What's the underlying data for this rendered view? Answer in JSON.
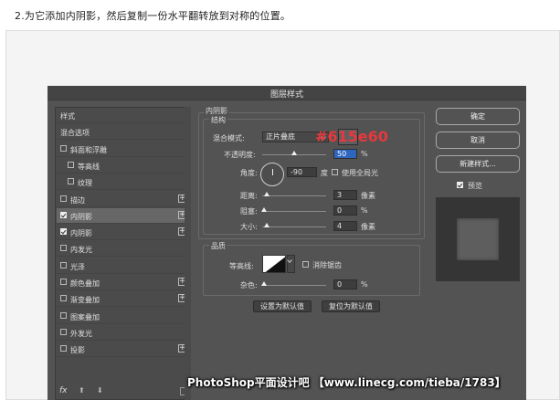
{
  "instruction": "2.为它添加内阴影，然后复制一份水平翻转放到对称的位置。",
  "dialog": {
    "title": "图层样式",
    "sidebar": {
      "items": [
        {
          "label": "样式",
          "checkbox": null,
          "checked": false,
          "plus": false,
          "indent": 0,
          "selected": false
        },
        {
          "label": "混合选项",
          "checkbox": null,
          "checked": false,
          "plus": false,
          "indent": 0,
          "selected": false
        },
        {
          "label": "斜面和浮雕",
          "checkbox": true,
          "checked": false,
          "plus": false,
          "indent": 0,
          "selected": false
        },
        {
          "label": "等高线",
          "checkbox": true,
          "checked": false,
          "plus": false,
          "indent": 1,
          "selected": false
        },
        {
          "label": "纹理",
          "checkbox": true,
          "checked": false,
          "plus": false,
          "indent": 1,
          "selected": false
        },
        {
          "label": "描边",
          "checkbox": true,
          "checked": false,
          "plus": true,
          "indent": 0,
          "selected": false
        },
        {
          "label": "内阴影",
          "checkbox": true,
          "checked": true,
          "plus": true,
          "indent": 0,
          "selected": true
        },
        {
          "label": "内阴影",
          "checkbox": true,
          "checked": true,
          "plus": true,
          "indent": 0,
          "selected": false
        },
        {
          "label": "内发光",
          "checkbox": true,
          "checked": false,
          "plus": false,
          "indent": 0,
          "selected": false
        },
        {
          "label": "光泽",
          "checkbox": true,
          "checked": false,
          "plus": false,
          "indent": 0,
          "selected": false
        },
        {
          "label": "颜色叠加",
          "checkbox": true,
          "checked": false,
          "plus": true,
          "indent": 0,
          "selected": false
        },
        {
          "label": "渐变叠加",
          "checkbox": true,
          "checked": false,
          "plus": true,
          "indent": 0,
          "selected": false
        },
        {
          "label": "图案叠加",
          "checkbox": true,
          "checked": false,
          "plus": false,
          "indent": 0,
          "selected": false
        },
        {
          "label": "外发光",
          "checkbox": true,
          "checked": false,
          "plus": false,
          "indent": 0,
          "selected": false
        },
        {
          "label": "投影",
          "checkbox": true,
          "checked": false,
          "plus": true,
          "indent": 0,
          "selected": false
        }
      ],
      "fx_label": "fx"
    },
    "inner_shadow": {
      "section_title": "内阴影",
      "structure_title": "结构",
      "blend_mode_label": "混合模式:",
      "blend_mode_value": "正片叠底",
      "shadow_color": "#615e60",
      "opacity_label": "不透明度:",
      "opacity_value": "50",
      "opacity_unit": "%",
      "angle_label": "角度:",
      "angle_value": "-90",
      "angle_unit": "度",
      "global_light_label": "使用全局光",
      "global_light_checked": false,
      "distance_label": "距离:",
      "distance_value": "3",
      "distance_unit": "像素",
      "choke_label": "阻塞:",
      "choke_value": "0",
      "choke_unit": "%",
      "size_label": "大小:",
      "size_value": "4",
      "size_unit": "像素",
      "quality_title": "品质",
      "contour_label": "等高线:",
      "anti_alias_label": "消除锯齿",
      "anti_alias_checked": false,
      "noise_label": "杂色:",
      "noise_value": "0",
      "noise_unit": "%",
      "make_default_label": "设置为默认值",
      "reset_default_label": "复位为默认值"
    },
    "buttons": {
      "ok": "确定",
      "cancel": "取消",
      "new_style": "新建样式...",
      "preview_label": "预览",
      "preview_checked": true
    }
  },
  "annotation_hex": "#615e60",
  "watermark": "PhotoShop平面设计吧 【www.linecg.com/tieba/1783】"
}
